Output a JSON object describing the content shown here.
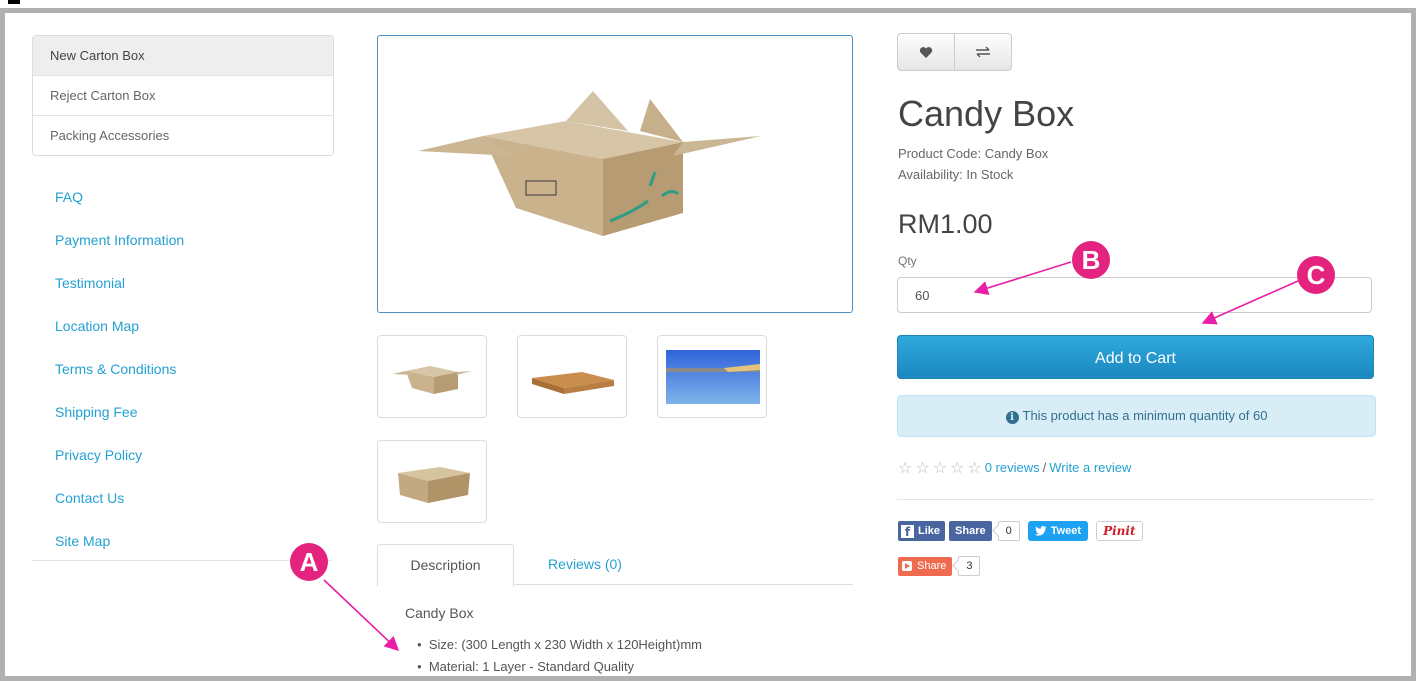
{
  "categories": [
    {
      "label": "New Carton Box",
      "active": true
    },
    {
      "label": "Reject Carton Box",
      "active": false
    },
    {
      "label": "Packing Accessories",
      "active": false
    }
  ],
  "info_links": [
    "FAQ",
    "Payment Information",
    "Testimonial",
    "Location Map",
    "Terms & Conditions",
    "Shipping Fee",
    "Privacy Policy",
    "Contact Us",
    "Site Map"
  ],
  "product": {
    "title": "Candy Box",
    "code": "Product Code: Candy Box",
    "availability": "Availability: In Stock",
    "price": "RM1.00",
    "qty_label": "Qty",
    "qty_value": "60",
    "add_to_cart": "Add to Cart",
    "min_qty_notice": "This product has a minimum quantity of 60",
    "rating": 0,
    "reviews_link": "0 reviews",
    "write_review_link": "Write a review"
  },
  "tabs": {
    "description": "Description",
    "reviews": "Reviews (0)"
  },
  "description": {
    "title": "Candy Box",
    "items": [
      "Size: (300 Length x 230 Width x 120Height)mm",
      "Material: 1 Layer - Standard Quality"
    ]
  },
  "social": {
    "fb_like": "Like",
    "fb_share": "Share",
    "fb_share_count": "0",
    "tweet": "Tweet",
    "pinit": "Pinit",
    "share": "Share",
    "share_count": "3"
  },
  "annotations": {
    "a": "A",
    "b": "B",
    "c": "C"
  },
  "colors": {
    "link": "#23a1d1",
    "cart_button": "#2196cf",
    "alert_bg": "#d9edf7",
    "marker": "#e3237e",
    "facebook": "#4a66a0",
    "twitter": "#1da1f2"
  }
}
